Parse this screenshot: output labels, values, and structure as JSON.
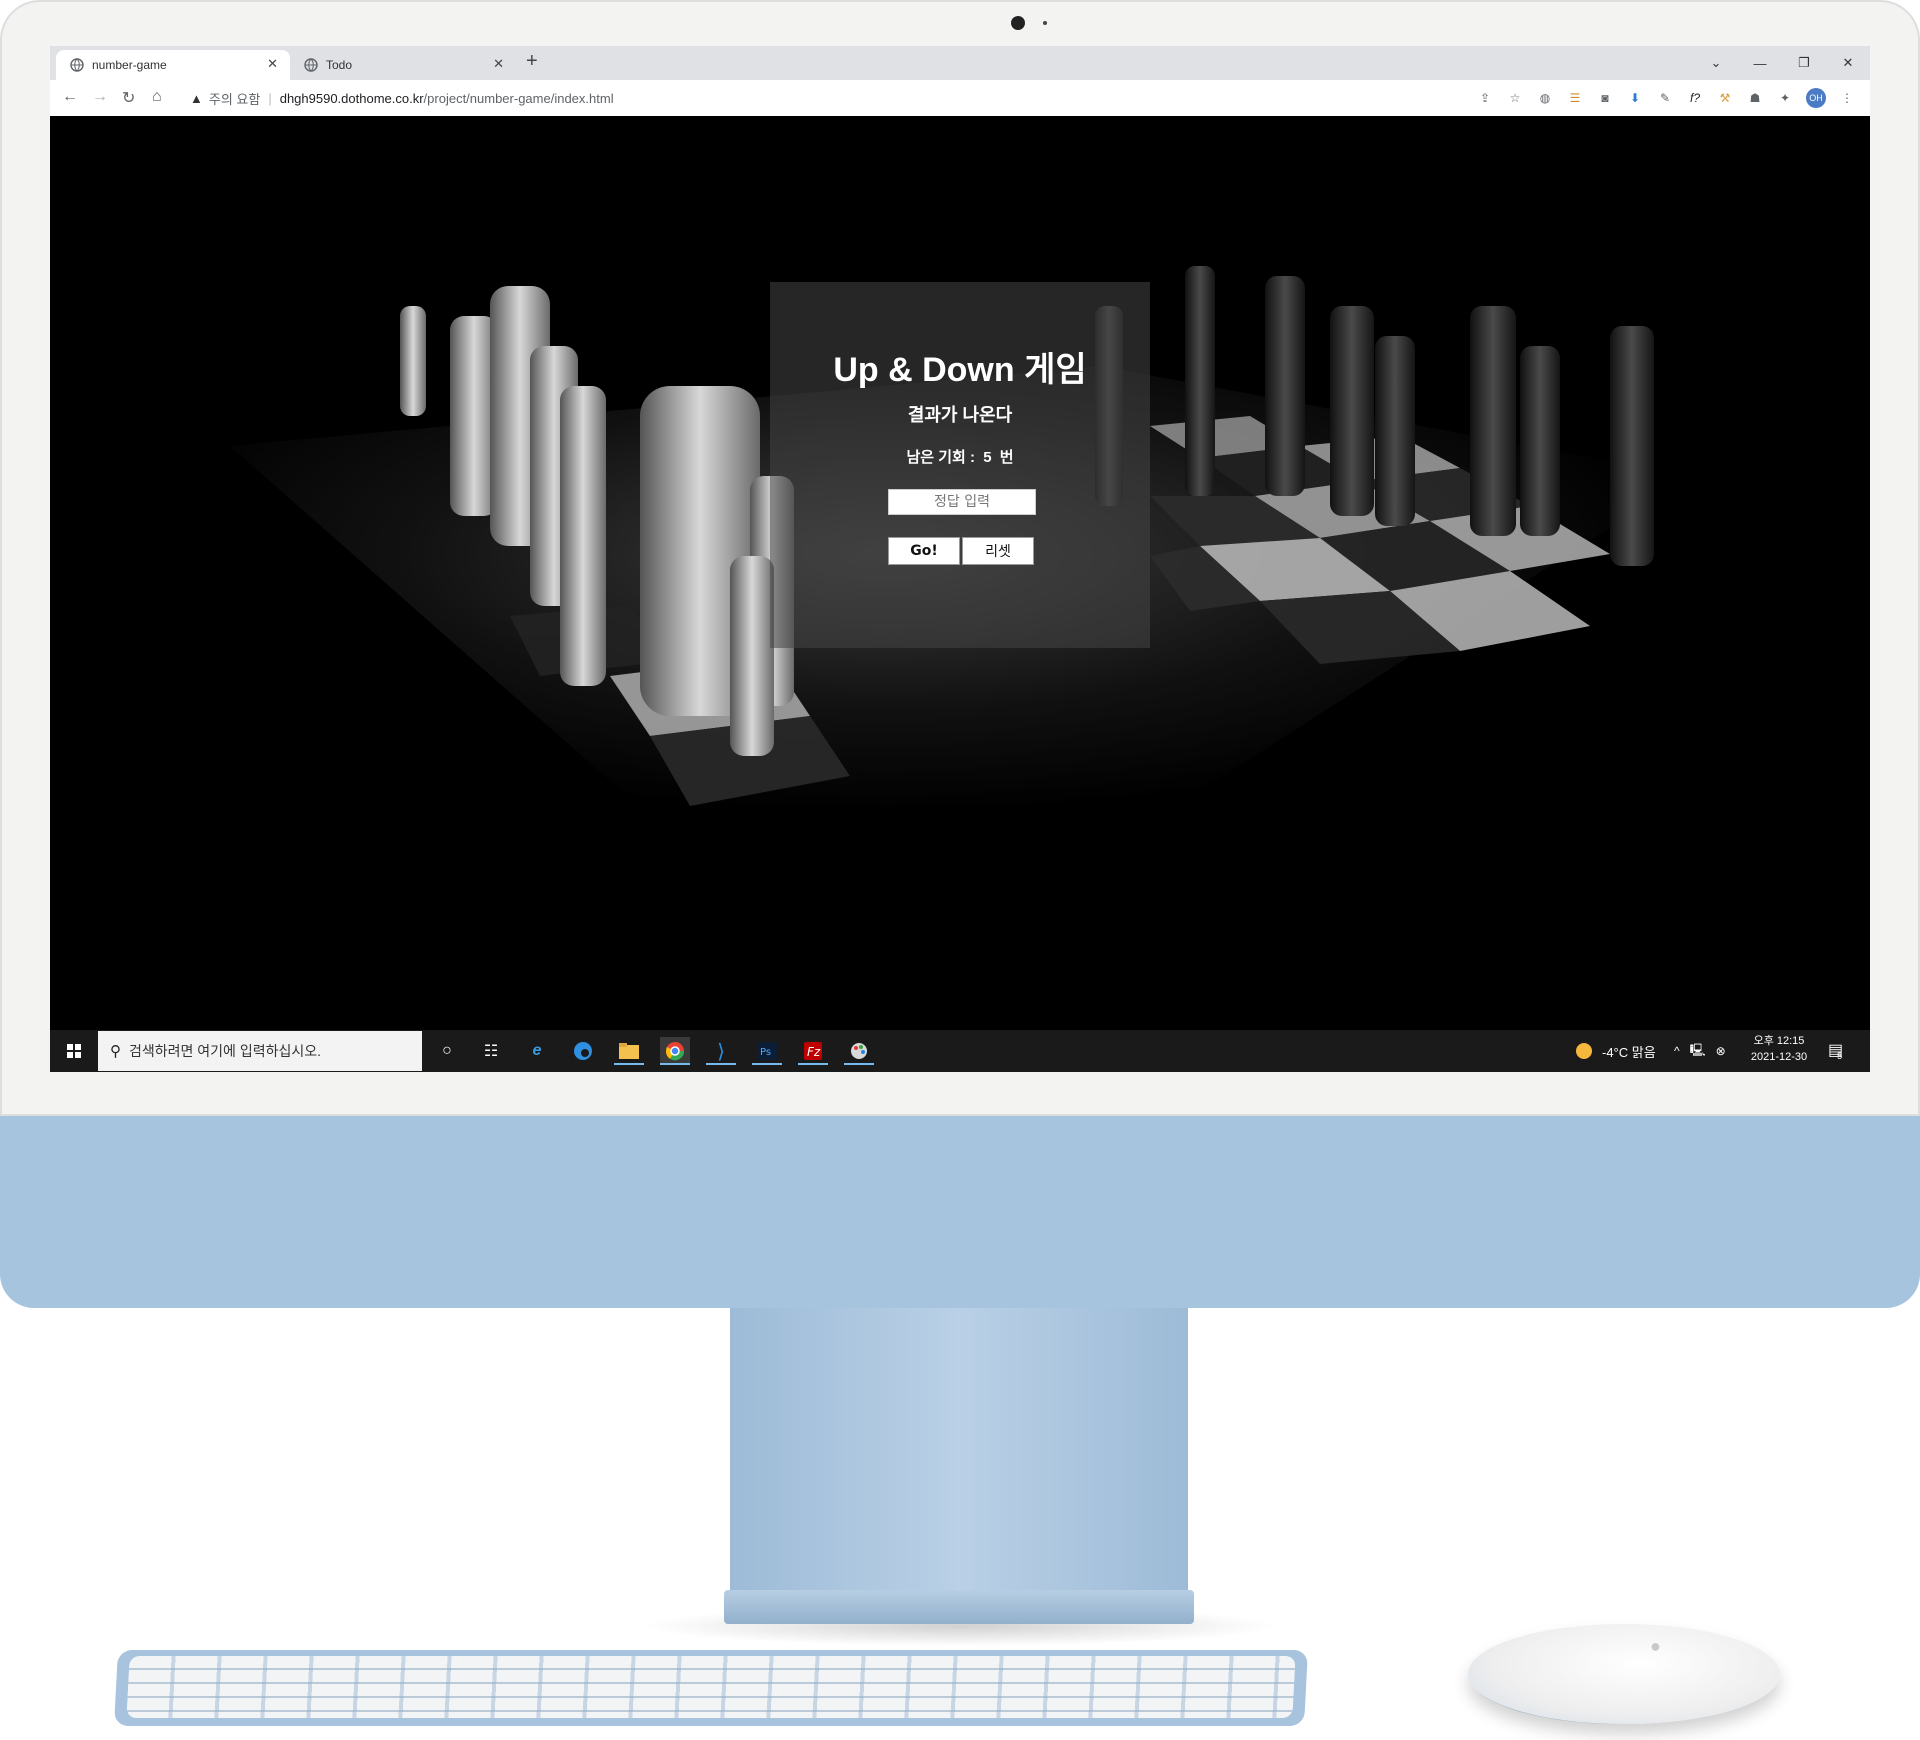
{
  "browser": {
    "tabs": [
      {
        "label": "number-game",
        "active": true
      },
      {
        "label": "Todo",
        "active": false
      }
    ],
    "security_label": "주의 요함",
    "url_host": "dhgh9590.dothome.co.kr",
    "url_path": "/project/number-game/index.html",
    "profile_initials": "OH"
  },
  "game": {
    "title": "Up & Down 게임",
    "result_text": "결과가 나온다",
    "chances_label": "남은 기회 :",
    "chances_value": "5",
    "chances_unit": "번",
    "input_placeholder": "정답 입력",
    "go_label": "Go!",
    "reset_label": "리셋"
  },
  "taskbar": {
    "search_placeholder": "검색하려면 여기에 입력하십시오.",
    "weather": "-4°C 맑음",
    "time": "오후 12:15",
    "date": "2021-12-30",
    "notification_count": "5",
    "pinned_apps": [
      "cortana-icon",
      "task-view-icon",
      "internet-explorer-icon",
      "edge-icon",
      "file-explorer-icon",
      "chrome-icon",
      "vscode-icon",
      "photoshop-icon",
      "filezilla-icon",
      "paint-icon"
    ]
  },
  "colors": {
    "imac_blue": "#a7c4df",
    "imac_white": "#f3f3f1",
    "taskbar": "#1a1a1a",
    "overlay": "rgba(70,70,70,0.55)"
  }
}
